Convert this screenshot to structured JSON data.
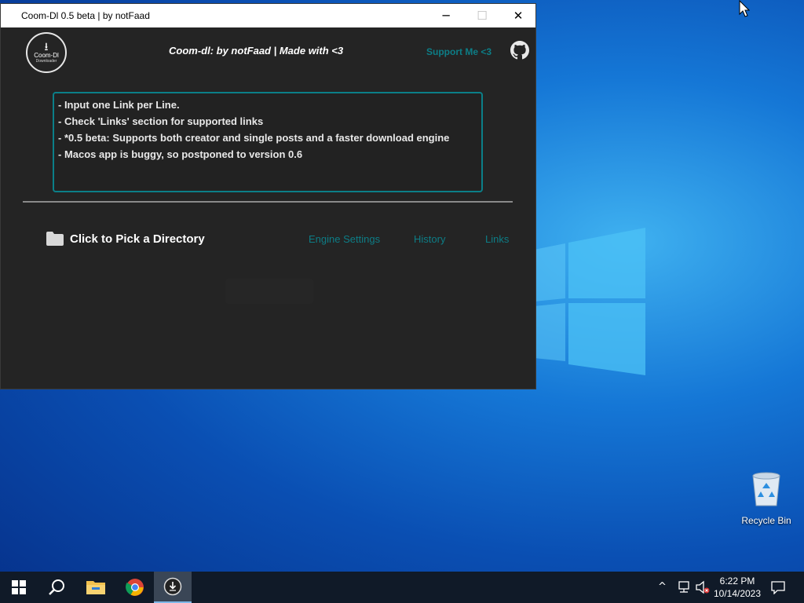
{
  "window": {
    "title": "Coom-Dl 0.5 beta | by notFaad",
    "minimize_glyph": "─",
    "maximize_glyph": "☐",
    "close_glyph": "✕"
  },
  "header": {
    "logo_text": "Coom-Dl",
    "logo_subtext": "Downloader",
    "logo_arrow": "⭳",
    "title": "Coom-dl:  by notFaad  |  Made with <3",
    "support_link": "Support Me <3",
    "github_icon": "github-icon"
  },
  "input_box": {
    "lines": [
      "- Input one Link per Line.",
      "- Check 'Links' section for supported links",
      "- *0.5 beta: Supports both creator and single posts and a faster download engine",
      "- Macos app is buggy, so postponed to version 0.6"
    ]
  },
  "actions": {
    "pick_directory": "Click to Pick a Directory",
    "engine_settings": "Engine Settings",
    "history": "History",
    "links": "Links"
  },
  "desktop": {
    "recycle_bin": "Recycle Bin"
  },
  "taskbar": {
    "time": "6:22 PM",
    "date": "10/14/2023",
    "chevron": "^"
  },
  "colors": {
    "accent": "#0d7d86",
    "window_bg": "#242424",
    "taskbar_bg": "#101a28"
  }
}
